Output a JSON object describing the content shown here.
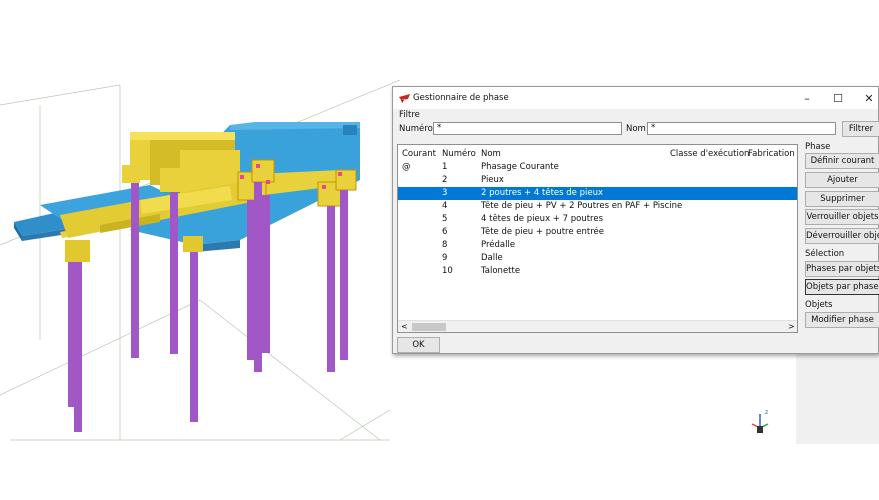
{
  "dialog": {
    "title": "Gestionnaire de phase",
    "minimize": "–",
    "maximize": "☐",
    "close": "✕",
    "filter_group": "Filtre",
    "numero_label": "Numéro",
    "numero_value": "*",
    "nom_label": "Nom",
    "nom_value": "*",
    "filter_button": "Filtrer",
    "ok_button": "OK"
  },
  "table": {
    "headers": [
      "Courant",
      "Numéro",
      "Nom",
      "Classe d'exécution",
      "Fabrication"
    ],
    "rows": [
      {
        "courant": "@",
        "numero": "1",
        "nom": "Phasage Courante",
        "selected": false
      },
      {
        "courant": "",
        "numero": "2",
        "nom": "Pieux",
        "selected": false
      },
      {
        "courant": "",
        "numero": "3",
        "nom": "2 poutres + 4 têtes de pieux",
        "selected": true
      },
      {
        "courant": "",
        "numero": "4",
        "nom": "Tête de pieu + PV + 2 Poutres en PAF + Piscine",
        "selected": false
      },
      {
        "courant": "",
        "numero": "5",
        "nom": "4 têtes de pieux + 7 poutres",
        "selected": false
      },
      {
        "courant": "",
        "numero": "6",
        "nom": "Tête de pieu + poutre entrée",
        "selected": false
      },
      {
        "courant": "",
        "numero": "8",
        "nom": "Prédalle",
        "selected": false
      },
      {
        "courant": "",
        "numero": "9",
        "nom": "Dalle",
        "selected": false
      },
      {
        "courant": "",
        "numero": "10",
        "nom": "Talonette",
        "selected": false
      }
    ],
    "scroll_left": "<",
    "scroll_right": ">"
  },
  "side": {
    "phase_group": "Phase",
    "definir_courant": "Définir courant",
    "ajouter": "Ajouter",
    "supprimer": "Supprimer",
    "verrouiller": "Verrouiller objets",
    "deverrouiller": "Déverrouiller objets",
    "selection_group": "Sélection",
    "phases_par_objets": "Phases par objets",
    "objets_par_phases": "Objets par phases",
    "objets_group": "Objets",
    "modifier_phase": "Modifier phase"
  },
  "colors": {
    "accent": "#0078d7",
    "pile": "#a257c6",
    "beam": "#e8d13a",
    "slab": "#3a9fd6"
  },
  "axis": {
    "z_label": "z"
  }
}
